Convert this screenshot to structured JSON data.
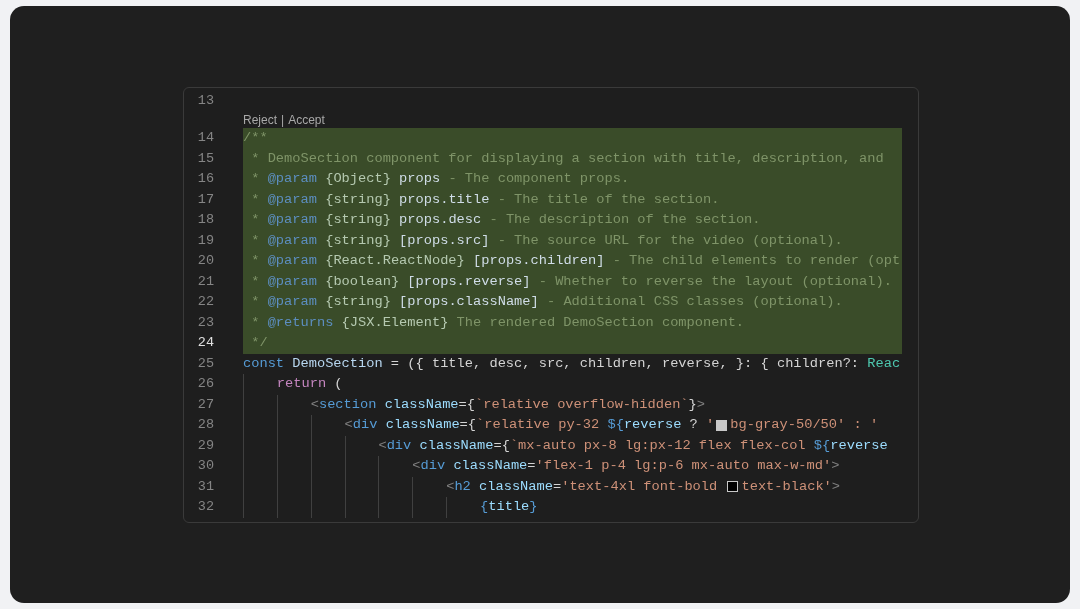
{
  "codelens": {
    "reject": "Reject",
    "separator": "|",
    "accept": "Accept"
  },
  "lines": [
    {
      "number": "13",
      "added": false,
      "current": false
    },
    {
      "number": "14",
      "added": true,
      "current": false,
      "tokens": [
        {
          "text": "/**",
          "kind": "comment"
        }
      ]
    },
    {
      "number": "15",
      "added": true,
      "current": false,
      "tokens": [
        {
          "text": " * DemoSection component for displaying a section with title, description, and",
          "kind": "comment"
        }
      ]
    },
    {
      "number": "16",
      "added": true,
      "current": false,
      "tokens": [
        {
          "text": " * ",
          "kind": "comment"
        },
        {
          "text": "@param",
          "kind": "doctag"
        },
        {
          "text": " {Object}",
          "kind": "type"
        },
        {
          "text": " props",
          "kind": "param"
        },
        {
          "text": " - The component props.",
          "kind": "comment"
        }
      ]
    },
    {
      "number": "17",
      "added": true,
      "current": false,
      "tokens": [
        {
          "text": " * ",
          "kind": "comment"
        },
        {
          "text": "@param",
          "kind": "doctag"
        },
        {
          "text": " {string}",
          "kind": "type"
        },
        {
          "text": " props.title",
          "kind": "param"
        },
        {
          "text": " - The title of the section.",
          "kind": "comment"
        }
      ]
    },
    {
      "number": "18",
      "added": true,
      "current": false,
      "tokens": [
        {
          "text": " * ",
          "kind": "comment"
        },
        {
          "text": "@param",
          "kind": "doctag"
        },
        {
          "text": " {string}",
          "kind": "type"
        },
        {
          "text": " props.desc",
          "kind": "param"
        },
        {
          "text": " - The description of the section.",
          "kind": "comment"
        }
      ]
    },
    {
      "number": "19",
      "added": true,
      "current": false,
      "tokens": [
        {
          "text": " * ",
          "kind": "comment"
        },
        {
          "text": "@param",
          "kind": "doctag"
        },
        {
          "text": " {string}",
          "kind": "type"
        },
        {
          "text": " [props.src]",
          "kind": "param"
        },
        {
          "text": " - The source URL for the video (optional).",
          "kind": "comment"
        }
      ]
    },
    {
      "number": "20",
      "added": true,
      "current": false,
      "tokens": [
        {
          "text": " * ",
          "kind": "comment"
        },
        {
          "text": "@param",
          "kind": "doctag"
        },
        {
          "text": " {React.ReactNode}",
          "kind": "type"
        },
        {
          "text": " [props.children]",
          "kind": "param"
        },
        {
          "text": " - The child elements to render (opt",
          "kind": "comment"
        }
      ]
    },
    {
      "number": "21",
      "added": true,
      "current": false,
      "tokens": [
        {
          "text": " * ",
          "kind": "comment"
        },
        {
          "text": "@param",
          "kind": "doctag"
        },
        {
          "text": " {boolean}",
          "kind": "type"
        },
        {
          "text": " [props.reverse]",
          "kind": "param"
        },
        {
          "text": " - Whether to reverse the layout (optional).",
          "kind": "comment"
        }
      ]
    },
    {
      "number": "22",
      "added": true,
      "current": false,
      "tokens": [
        {
          "text": " * ",
          "kind": "comment"
        },
        {
          "text": "@param",
          "kind": "doctag"
        },
        {
          "text": " {string}",
          "kind": "type"
        },
        {
          "text": " [props.className]",
          "kind": "param"
        },
        {
          "text": " - Additional CSS classes (optional).",
          "kind": "comment"
        }
      ]
    },
    {
      "number": "23",
      "added": true,
      "current": false,
      "tokens": [
        {
          "text": " * ",
          "kind": "comment"
        },
        {
          "text": "@returns",
          "kind": "doctag"
        },
        {
          "text": " {JSX.Element}",
          "kind": "type"
        },
        {
          "text": " The rendered DemoSection component.",
          "kind": "comment"
        }
      ]
    },
    {
      "number": "24",
      "added": true,
      "current": true,
      "tokens": [
        {
          "text": " */",
          "kind": "comment"
        }
      ]
    },
    {
      "number": "25",
      "added": false,
      "current": false,
      "tokens": [
        {
          "text": "const",
          "kind": "keyword"
        },
        {
          "text": " DemoSection",
          "kind": "variable"
        },
        {
          "text": " = ({ title, desc, src, children, reverse, }: { children?: ",
          "kind": "plain"
        },
        {
          "text": "Reac",
          "kind": "typename"
        }
      ]
    },
    {
      "number": "26",
      "added": false,
      "current": false,
      "tokens": [
        {
          "text": "    return",
          "kind": "control"
        },
        {
          "text": " (",
          "kind": "plain"
        }
      ]
    },
    {
      "number": "27",
      "added": false,
      "current": false,
      "tokens": [
        {
          "text": "        <",
          "kind": "bracket"
        },
        {
          "text": "section",
          "kind": "tag"
        },
        {
          "text": " className",
          "kind": "attr"
        },
        {
          "text": "={",
          "kind": "plain"
        },
        {
          "text": "`relative overflow-hidden`",
          "kind": "string"
        },
        {
          "text": "}",
          "kind": "plain"
        },
        {
          "text": ">",
          "kind": "bracket"
        }
      ]
    },
    {
      "number": "28",
      "added": false,
      "current": false,
      "tokens": [
        {
          "text": "            <",
          "kind": "bracket"
        },
        {
          "text": "div",
          "kind": "tag"
        },
        {
          "text": " className",
          "kind": "attr"
        },
        {
          "text": "={",
          "kind": "plain"
        },
        {
          "text": "`relative py-32 ",
          "kind": "string"
        },
        {
          "text": "${",
          "kind": "interp"
        },
        {
          "text": "reverse",
          "kind": "param"
        },
        {
          "text": " ? ",
          "kind": "plain"
        },
        {
          "text": "'",
          "kind": "string"
        },
        {
          "kind": "swatch",
          "color": "#c8c8c8"
        },
        {
          "text": "bg-gray-50/50' : '",
          "kind": "string"
        }
      ]
    },
    {
      "number": "29",
      "added": false,
      "current": false,
      "tokens": [
        {
          "text": "                <",
          "kind": "bracket"
        },
        {
          "text": "div",
          "kind": "tag"
        },
        {
          "text": " className",
          "kind": "attr"
        },
        {
          "text": "={",
          "kind": "plain"
        },
        {
          "text": "`mx-auto px-8 lg:px-12 flex flex-col ",
          "kind": "string"
        },
        {
          "text": "${",
          "kind": "interp"
        },
        {
          "text": "reverse",
          "kind": "param"
        }
      ]
    },
    {
      "number": "30",
      "added": false,
      "current": false,
      "tokens": [
        {
          "text": "                    <",
          "kind": "bracket"
        },
        {
          "text": "div",
          "kind": "tag"
        },
        {
          "text": " className",
          "kind": "attr"
        },
        {
          "text": "=",
          "kind": "plain"
        },
        {
          "text": "'flex-1 p-4 lg:p-6 mx-auto max-w-md'",
          "kind": "string"
        },
        {
          "text": ">",
          "kind": "bracket"
        }
      ]
    },
    {
      "number": "31",
      "added": false,
      "current": false,
      "tokens": [
        {
          "text": "                        <",
          "kind": "bracket"
        },
        {
          "text": "h2",
          "kind": "tag"
        },
        {
          "text": " className",
          "kind": "attr"
        },
        {
          "text": "=",
          "kind": "plain"
        },
        {
          "text": "'text-4xl font-bold ",
          "kind": "string"
        },
        {
          "kind": "swatch",
          "color": "#000000"
        },
        {
          "text": "text-black'",
          "kind": "string"
        },
        {
          "text": ">",
          "kind": "bracket"
        }
      ]
    },
    {
      "number": "32",
      "added": false,
      "current": false,
      "tokens": [
        {
          "text": "                            {",
          "kind": "interp"
        },
        {
          "text": "title",
          "kind": "param"
        },
        {
          "text": "}",
          "kind": "interp"
        }
      ]
    }
  ]
}
